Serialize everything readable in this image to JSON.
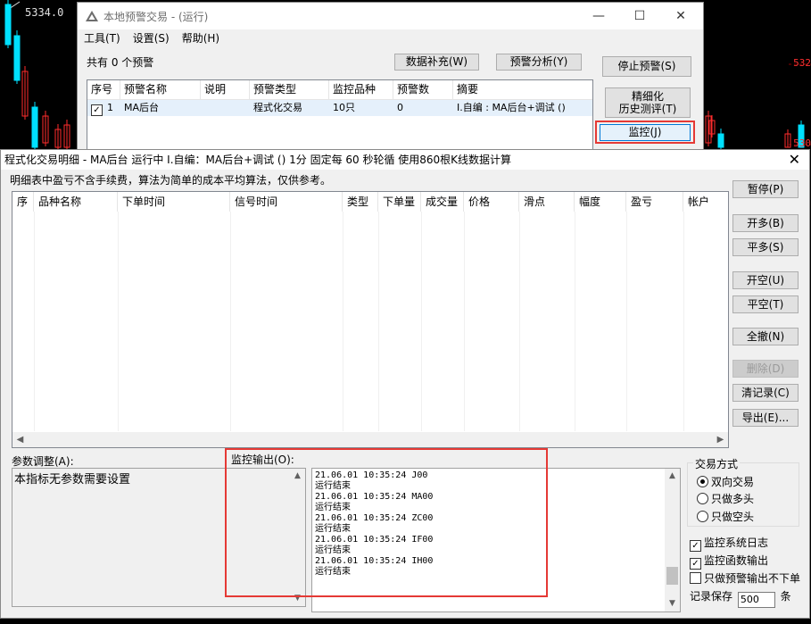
{
  "chart_bg": {
    "price_top": "5334.0",
    "price_right_1": "532",
    "price_right_2": "530",
    "colors": {
      "up": "#ff2d2d",
      "down": "#00e0ff",
      "grid": "#8b0000"
    }
  },
  "back_window": {
    "title": "本地预警交易 - (运行)",
    "menu": [
      "工具(T)",
      "设置(S)",
      "帮助(H)"
    ],
    "count_label": "共有 0 个预警",
    "btn_data_fill": "数据补充(W)",
    "btn_alert_analysis": "预警分析(Y)",
    "btn_stop": "停止预警(S)",
    "btn_refine_line1": "精细化",
    "btn_refine_line2": "历史测评(T)",
    "btn_monitor": "监控(J)",
    "columns": [
      "序号",
      "预警名称",
      "说明",
      "预警类型",
      "监控品种",
      "预警数",
      "摘要"
    ],
    "row": {
      "index": "1",
      "name": "MA后台",
      "desc": "",
      "type": "程式化交易",
      "symbols": "10只",
      "alerts": "0",
      "summary": "I.自编 : MA后台+调试 ()"
    }
  },
  "front_window": {
    "title": "程式化交易明细 - MA后台 运行中 I.自编：MA后台+调试 () 1分 固定每 60 秒轮循 使用860根K线数据计算",
    "note": "明细表中盈亏不含手续费，算法为简单的成本平均算法，仅供参考。",
    "columns": [
      "序",
      "品种名称",
      "下单时间",
      "信号时间",
      "类型",
      "下单量",
      "成交量",
      "价格",
      "滑点",
      "幅度",
      "盈亏",
      "帐户"
    ],
    "buttons": {
      "pause": "暂停(P)",
      "open_long": "开多(B)",
      "close_long": "平多(S)",
      "open_short": "开空(U)",
      "close_short": "平空(T)",
      "close_all": "全撤(N)",
      "delete": "删除(D)",
      "clear": "清记录(C)",
      "export": "导出(E)..."
    },
    "param_label": "参数调整(A):",
    "param_text": "本指标无参数需要设置",
    "output_label": "监控输出(O):",
    "output_lines": [
      "21.06.01 10:35:24 J00",
      "运行结束",
      "21.06.01 10:35:24 MA00",
      "运行结束",
      "21.06.01 10:35:24 ZC00",
      "运行结束",
      "21.06.01 10:35:24 IF00",
      "运行结束",
      "21.06.01 10:35:24 IH00",
      "运行结束"
    ],
    "trade_mode_label": "交易方式",
    "trade_modes": [
      "双向交易",
      "只做多头",
      "只做空头"
    ],
    "selected_mode": "双向交易",
    "check_sys_log": "监控系统日志",
    "check_func_out": "监控函数输出",
    "check_alert_only": "只做预警输出不下单",
    "record_keep_label": "记录保存",
    "record_keep_value": "500",
    "record_unit": "条"
  }
}
